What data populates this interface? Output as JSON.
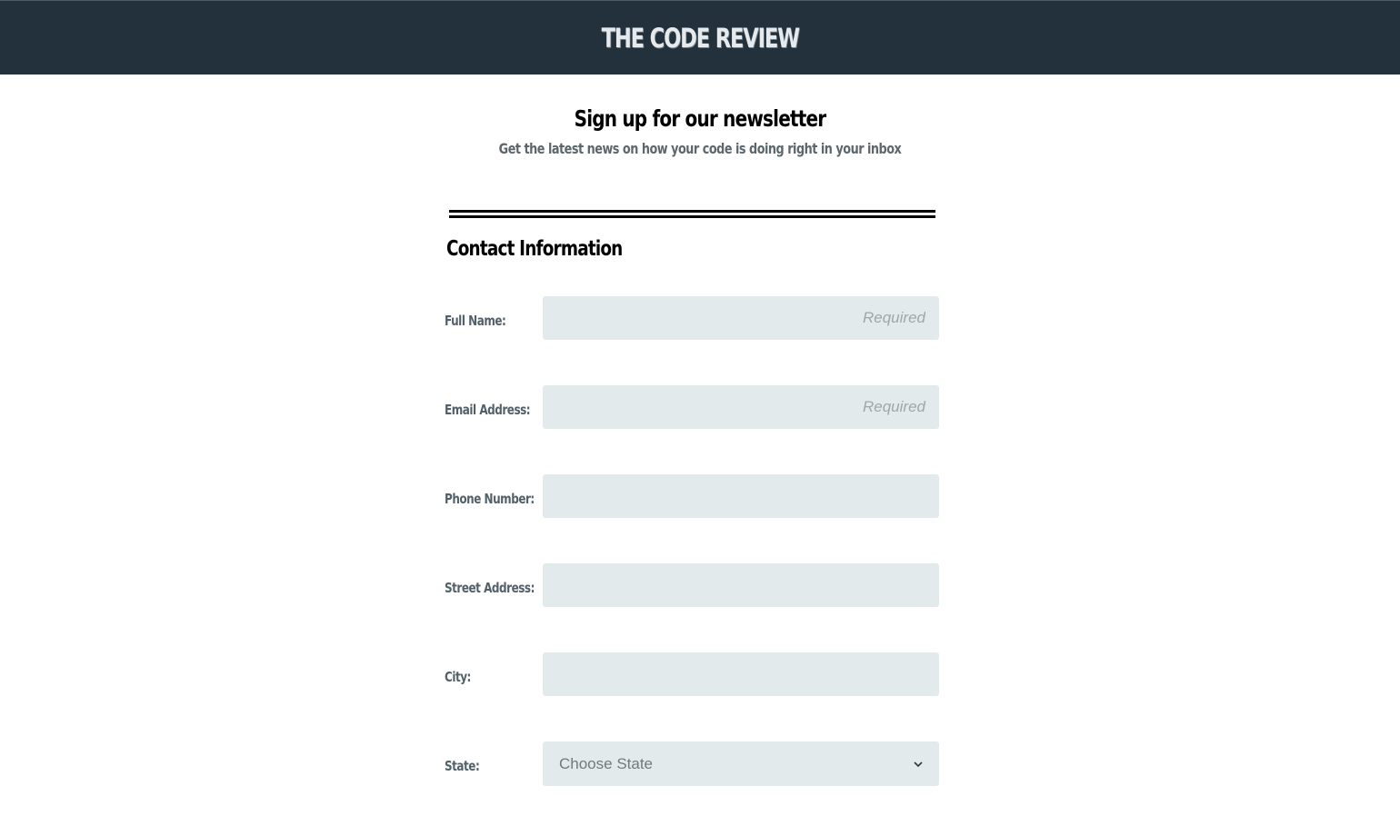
{
  "site": {
    "title": "THE CODE REVIEW"
  },
  "header": {
    "heading": "Sign up for our newsletter",
    "subheading": "Get the latest news on how your code is doing right in your inbox"
  },
  "section": {
    "title": "Contact Information"
  },
  "form": {
    "full_name": {
      "label": "Full Name:",
      "placeholder": "Required"
    },
    "email": {
      "label": "Email Address:",
      "placeholder": "Required"
    },
    "phone": {
      "label": "Phone Number:",
      "placeholder": ""
    },
    "street": {
      "label": "Street Address:",
      "placeholder": ""
    },
    "city": {
      "label": "City:",
      "placeholder": ""
    },
    "state": {
      "label": "State:",
      "selected": "Choose State",
      "icon": "chevron-down-icon"
    }
  }
}
